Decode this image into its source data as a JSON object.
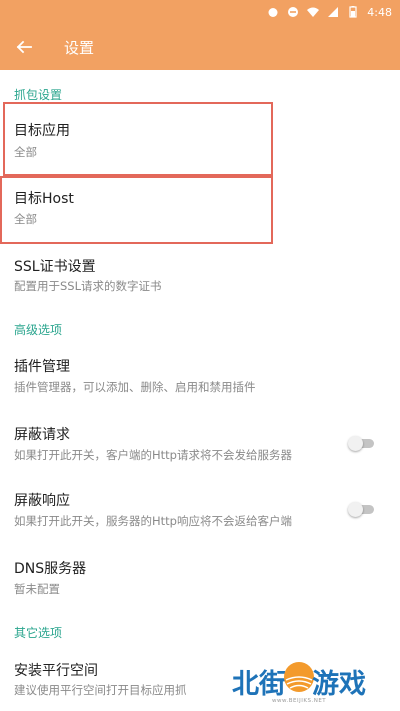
{
  "status_bar": {
    "time": "4:48"
  },
  "app_bar": {
    "title": "设置"
  },
  "sections": {
    "capture": "抓包设置",
    "advanced": "高级选项",
    "other": "其它选项"
  },
  "prefs": {
    "target_app": {
      "title": "目标应用",
      "summary": "全部"
    },
    "target_host": {
      "title": "目标Host",
      "summary": "全部"
    },
    "ssl": {
      "title": "SSL证书设置",
      "summary": "配置用于SSL请求的数字证书"
    },
    "plugins": {
      "title": "插件管理",
      "summary": "插件管理器，可以添加、删除、启用和禁用插件"
    },
    "block_request": {
      "title": "屏蔽请求",
      "summary": "如果打开此开关，客户端的Http请求将不会发给服务器",
      "enabled": false
    },
    "block_response": {
      "title": "屏蔽响应",
      "summary": "如果打开此开关，服务器的Http响应将不会返给客户端",
      "enabled": false
    },
    "dns": {
      "title": "DNS服务器",
      "summary": "暂未配置"
    },
    "parallel": {
      "title": "安装平行空间",
      "summary": "建议使用平行空间打开目标应用抓"
    }
  },
  "watermark": {
    "left": "北街",
    "right": "游戏",
    "url": "www.BEIJIKS.NET"
  },
  "colors": {
    "primary": "#f2a162",
    "accent": "#2aa58e",
    "highlight_box": "#e3685a"
  }
}
